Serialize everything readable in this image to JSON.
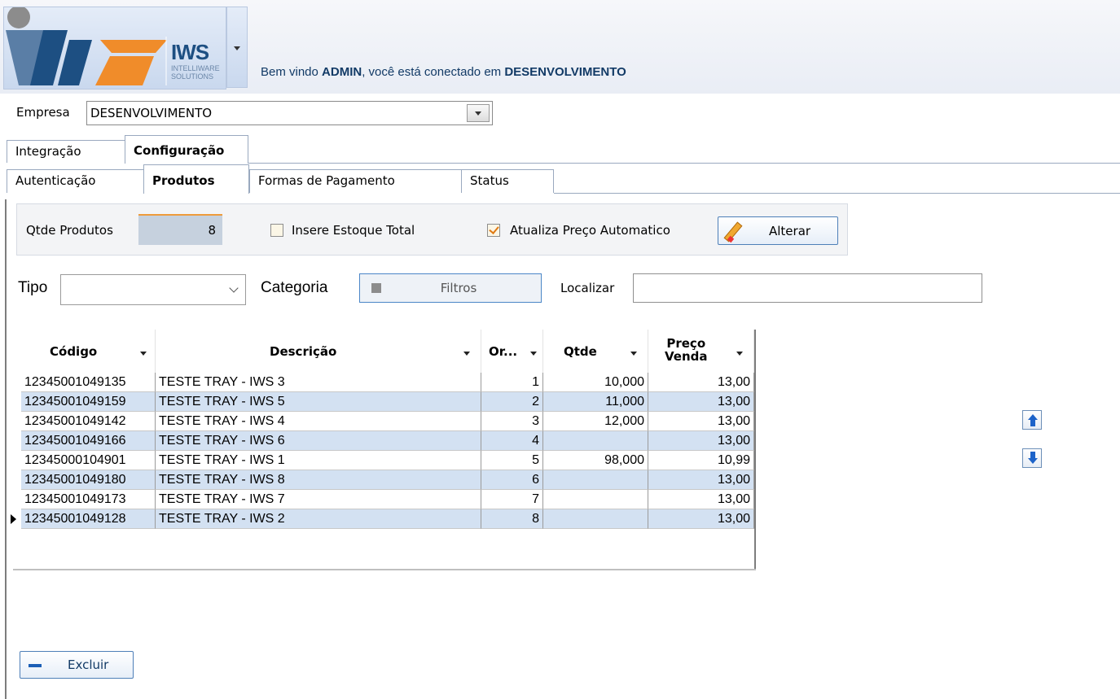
{
  "header": {
    "logo_text": "IWS",
    "logo_sub_1": "INTELLIWARE",
    "logo_sub_2": "SOLUTIONS",
    "welcome_prefix": "Bem vindo ",
    "user": "ADMIN",
    "welcome_middle": ", você está conectado em ",
    "environment": "DESENVOLVIMENTO"
  },
  "empresa": {
    "label": "Empresa",
    "value": "DESENVOLVIMENTO"
  },
  "main_tabs": [
    {
      "label": "Integração",
      "active": false
    },
    {
      "label": "Configuração",
      "active": true
    }
  ],
  "sub_tabs": [
    {
      "label": "Autenticação",
      "active": false
    },
    {
      "label": "Produtos",
      "active": true
    },
    {
      "label": "Formas de Pagamento",
      "active": false
    },
    {
      "label": "Status",
      "active": false
    }
  ],
  "produtos": {
    "qtde_label": "Qtde Produtos",
    "qtde_value": "8",
    "insere_estoque_label": "Insere Estoque Total",
    "insere_estoque_checked": false,
    "atualiza_preco_label": "Atualiza Preço Automatico",
    "atualiza_preco_checked": true,
    "alterar_label": "Alterar"
  },
  "filters": {
    "tipo_label": "Tipo",
    "tipo_value": "",
    "categoria_label": "Categoria",
    "filtros_label": "Filtros",
    "localizar_label": "Localizar",
    "localizar_value": ""
  },
  "grid": {
    "columns": [
      "Código",
      "Descrição",
      "Or...",
      "Qtde",
      "Preço",
      "Venda"
    ],
    "rows": [
      {
        "codigo": "12345001049135",
        "descricao": "TESTE TRAY - IWS 3",
        "ordem": "1",
        "qtde": "10,000",
        "preco": "13,00"
      },
      {
        "codigo": "12345001049159",
        "descricao": "TESTE TRAY - IWS 5",
        "ordem": "2",
        "qtde": "11,000",
        "preco": "13,00"
      },
      {
        "codigo": "12345001049142",
        "descricao": "TESTE TRAY - IWS 4",
        "ordem": "3",
        "qtde": "12,000",
        "preco": "13,00"
      },
      {
        "codigo": "12345001049166",
        "descricao": "TESTE TRAY - IWS 6",
        "ordem": "4",
        "qtde": "",
        "preco": "13,00"
      },
      {
        "codigo": "12345000104901",
        "descricao": "TESTE TRAY - IWS 1",
        "ordem": "5",
        "qtde": "98,000",
        "preco": "10,99"
      },
      {
        "codigo": "12345001049180",
        "descricao": "TESTE TRAY - IWS 8",
        "ordem": "6",
        "qtde": "",
        "preco": "13,00"
      },
      {
        "codigo": "12345001049173",
        "descricao": "TESTE TRAY - IWS 7",
        "ordem": "7",
        "qtde": "",
        "preco": "13,00"
      },
      {
        "codigo": "12345001049128",
        "descricao": "TESTE TRAY - IWS 2",
        "ordem": "8",
        "qtde": "",
        "preco": "13,00"
      }
    ],
    "selected_row": 7,
    "row_colors": [
      "#ffffff",
      "#d3e1f2"
    ]
  },
  "actions": {
    "excluir_label": "Excluir",
    "move_up_icon": "arrow-up-icon",
    "move_down_icon": "arrow-down-icon"
  },
  "colors": {
    "accent_orange": "#ee9b3b",
    "header_blue": "#123a66",
    "alt_row": "#d3e1f2"
  }
}
